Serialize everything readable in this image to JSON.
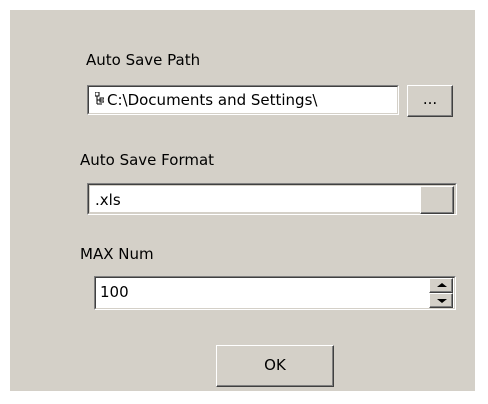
{
  "dialog": {
    "auto_save_path": {
      "label": "Auto Save Path",
      "value": "C:\\Documents and Settings\\",
      "browse_label": "..."
    },
    "auto_save_format": {
      "label": "Auto Save Format",
      "value": ".xls"
    },
    "max_num": {
      "label": "MAX Num",
      "value": "100"
    },
    "ok_label": "OK"
  }
}
